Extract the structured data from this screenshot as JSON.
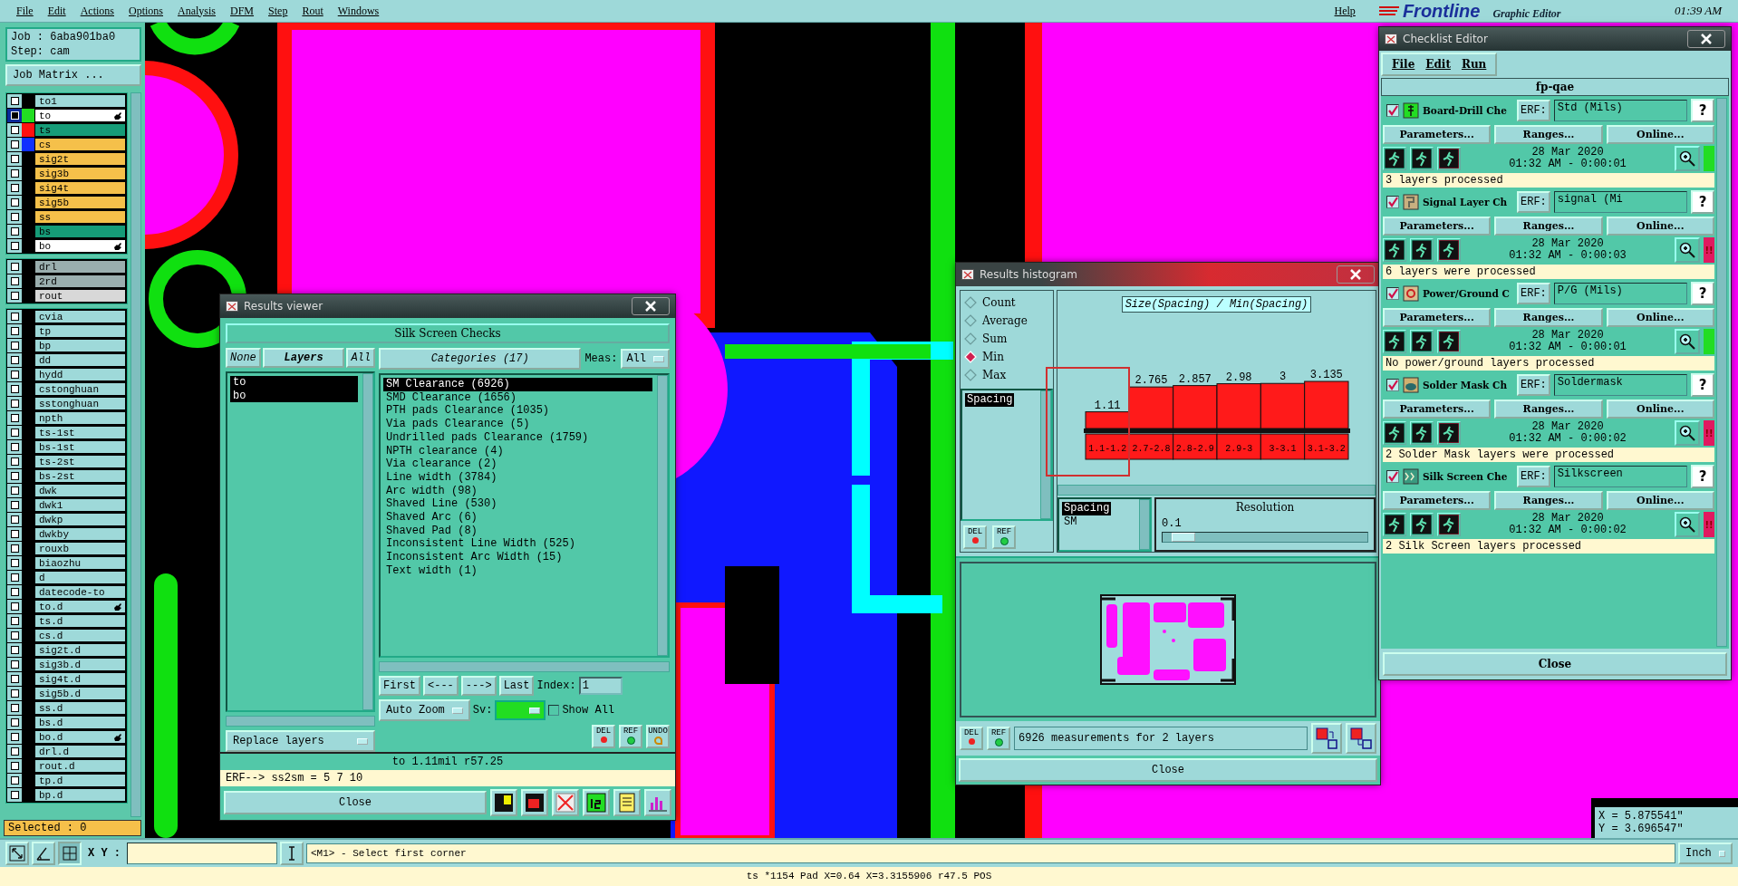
{
  "menu_bar": {
    "items": [
      "File",
      "Edit",
      "Actions",
      "Options",
      "Analysis",
      "DFM",
      "Step",
      "Rout",
      "Windows"
    ],
    "help": "Help"
  },
  "logo": {
    "brand": "Frontline",
    "subtitle": "Graphic Editor"
  },
  "clock": "01:39 AM",
  "job_panel": {
    "job": "Job : 6aba901ba0",
    "step": "Step: cam",
    "job_matrix": "Job Matrix ...",
    "selected_count": "Selected : 0",
    "layer_groups": [
      [
        {
          "name": "to1",
          "color": "#9ed9d9",
          "selected": false,
          "affected": false
        },
        {
          "name": "to",
          "color": "#ffffff",
          "swatch": {
            "color": "#22dd22"
          },
          "selected": true,
          "affected": true
        },
        {
          "name": "ts",
          "color": "#169c78",
          "swatch": {
            "color": "#ff1010"
          },
          "selected": false,
          "affected": false
        },
        {
          "name": "cs",
          "color": "#f5c04a",
          "swatch": {
            "color": "#1030ff"
          },
          "selected": false,
          "affected": false
        },
        {
          "name": "sig2t",
          "color": "#f5c04a",
          "selected": false,
          "affected": false
        },
        {
          "name": "sig3b",
          "color": "#f5c04a",
          "selected": false,
          "affected": false
        },
        {
          "name": "sig4t",
          "color": "#f5c04a",
          "selected": false,
          "affected": false
        },
        {
          "name": "sig5b",
          "color": "#f5c04a",
          "selected": false,
          "affected": false
        },
        {
          "name": "ss",
          "color": "#f5c04a",
          "selected": false,
          "affected": false
        },
        {
          "name": "bs",
          "color": "#169c78",
          "selected": false,
          "affected": false
        },
        {
          "name": "bo",
          "color": "#ffffff",
          "selected": false,
          "affected": true
        }
      ],
      [
        {
          "name": "drl",
          "color": "#9aaeae",
          "selected": false,
          "affected": false
        },
        {
          "name": "2rd",
          "color": "#9aaeae",
          "selected": false,
          "affected": false
        },
        {
          "name": "rout",
          "color": "#d8d8d8",
          "selected": false,
          "affected": false
        }
      ],
      [
        {
          "name": "cvia",
          "color": "#9ed9d9",
          "selected": false,
          "affected": false
        },
        {
          "name": "tp",
          "color": "#9ed9d9",
          "selected": false,
          "affected": false
        },
        {
          "name": "bp",
          "color": "#9ed9d9",
          "selected": false,
          "affected": false
        },
        {
          "name": "dd",
          "color": "#9ed9d9",
          "selected": false,
          "affected": false
        },
        {
          "name": "hydd",
          "color": "#9ed9d9",
          "selected": false,
          "affected": false
        },
        {
          "name": "cstonghuan",
          "color": "#9ed9d9",
          "selected": false,
          "affected": false
        },
        {
          "name": "sstonghuan",
          "color": "#9ed9d9",
          "selected": false,
          "affected": false
        },
        {
          "name": "npth",
          "color": "#9ed9d9",
          "selected": false,
          "affected": false
        },
        {
          "name": "ts-1st",
          "color": "#9ed9d9",
          "selected": false,
          "affected": false
        },
        {
          "name": "bs-1st",
          "color": "#9ed9d9",
          "selected": false,
          "affected": false
        },
        {
          "name": "ts-2st",
          "color": "#9ed9d9",
          "selected": false,
          "affected": false
        },
        {
          "name": "bs-2st",
          "color": "#9ed9d9",
          "selected": false,
          "affected": false
        },
        {
          "name": "dwk",
          "color": "#9ed9d9",
          "selected": false,
          "affected": false
        },
        {
          "name": "dwk1",
          "color": "#9ed9d9",
          "selected": false,
          "affected": false
        },
        {
          "name": "dwkp",
          "color": "#9ed9d9",
          "selected": false,
          "affected": false
        },
        {
          "name": "dwkby",
          "color": "#9ed9d9",
          "selected": false,
          "affected": false
        },
        {
          "name": "rouxb",
          "color": "#9ed9d9",
          "selected": false,
          "affected": false
        },
        {
          "name": "biaozhu",
          "color": "#9ed9d9",
          "selected": false,
          "affected": false
        },
        {
          "name": "d",
          "color": "#9ed9d9",
          "selected": false,
          "affected": false
        },
        {
          "name": "datecode-to",
          "color": "#9ed9d9",
          "selected": false,
          "affected": false
        },
        {
          "name": "to.d",
          "color": "#9ed9d9",
          "selected": false,
          "affected": true
        },
        {
          "name": "ts.d",
          "color": "#9ed9d9",
          "selected": false,
          "affected": false
        },
        {
          "name": "cs.d",
          "color": "#9ed9d9",
          "selected": false,
          "affected": false
        },
        {
          "name": "sig2t.d",
          "color": "#9ed9d9",
          "selected": false,
          "affected": false
        },
        {
          "name": "sig3b.d",
          "color": "#9ed9d9",
          "selected": false,
          "affected": false
        },
        {
          "name": "sig4t.d",
          "color": "#9ed9d9",
          "selected": false,
          "affected": false
        },
        {
          "name": "sig5b.d",
          "color": "#9ed9d9",
          "selected": false,
          "affected": false
        },
        {
          "name": "ss.d",
          "color": "#9ed9d9",
          "selected": false,
          "affected": false
        },
        {
          "name": "bs.d",
          "color": "#9ed9d9",
          "selected": false,
          "affected": false
        },
        {
          "name": "bo.d",
          "color": "#9ed9d9",
          "selected": false,
          "affected": true
        },
        {
          "name": "drl.d",
          "color": "#9ed9d9",
          "selected": false,
          "affected": false
        },
        {
          "name": "rout.d",
          "color": "#9ed9d9",
          "selected": false,
          "affected": false
        },
        {
          "name": "tp.d",
          "color": "#9ed9d9",
          "selected": false,
          "affected": false
        },
        {
          "name": "bp.d",
          "color": "#9ed9d9",
          "selected": false,
          "affected": false
        }
      ]
    ]
  },
  "results_viewer": {
    "title": "Results viewer",
    "heading": "Silk Screen Checks",
    "layer_buttons": [
      "None",
      "Layers",
      "All"
    ],
    "layers": [
      {
        "name": "to",
        "selected": true
      },
      {
        "name": "bo",
        "selected": true
      }
    ],
    "categories_header": "Categories (17)",
    "meas_label": "Meas:",
    "meas_value": "All",
    "categories": [
      {
        "label": "SM Clearance (6926)",
        "selected": true
      },
      {
        "label": "SMD Clearance (1656)",
        "selected": false
      },
      {
        "label": "PTH pads Clearance (1035)",
        "selected": false
      },
      {
        "label": "Via pads Clearance (5)",
        "selected": false
      },
      {
        "label": "Undrilled pads Clearance (1759)",
        "selected": false
      },
      {
        "label": "NPTH clearance (4)",
        "selected": false
      },
      {
        "label": "Via clearance (2)",
        "selected": false
      },
      {
        "label": "Line width (3784)",
        "selected": false
      },
      {
        "label": "Arc width (98)",
        "selected": false
      },
      {
        "label": "Shaved Line (530)",
        "selected": false
      },
      {
        "label": "Shaved Arc (6)",
        "selected": false
      },
      {
        "label": "Shaved Pad (8)",
        "selected": false
      },
      {
        "label": "Inconsistent Line Width (525)",
        "selected": false
      },
      {
        "label": "Inconsistent Arc Width (15)",
        "selected": false
      },
      {
        "label": "Text width (1)",
        "selected": false
      }
    ],
    "nav_buttons": [
      "First",
      "<---",
      "--->",
      "Last"
    ],
    "index_label": "Index:",
    "index_value": "1",
    "zoom_mode": "Auto Zoom",
    "sv_label": "Sv:",
    "show_all": {
      "label": "Show All",
      "checked": false
    },
    "replace_mode": "Replace layers",
    "action_buttons": [
      "DEL",
      "REF",
      "UNDO"
    ],
    "measurement": "to 1.11mil  r57.25",
    "erf_line": "ERF--> ss2sm = 5 7 10",
    "close": "Close"
  },
  "histogram": {
    "title": "Results histogram",
    "modes": [
      {
        "label": "Count",
        "selected": false
      },
      {
        "label": "Average",
        "selected": false
      },
      {
        "label": "Sum",
        "selected": false
      },
      {
        "label": "Min",
        "selected": true
      },
      {
        "label": "Max",
        "selected": false
      }
    ],
    "attributes": [
      {
        "label": "Spacing",
        "selected": true
      }
    ],
    "side_buttons": [
      "DEL",
      "REF"
    ],
    "chart_data": {
      "type": "bar",
      "title": "Size(Spacing) / Min(Spacing)",
      "categories": [
        "1.1-1.2",
        "2.7-2.8",
        "2.8-2.9",
        "2.9-3",
        "3-3.1",
        "3.1-3.2"
      ],
      "values": [
        1.11,
        2.765,
        2.857,
        2.98,
        3,
        3.135
      ],
      "data_labels": true
    },
    "fields": [
      {
        "label": "Spacing",
        "selected": true
      },
      {
        "label": "SM",
        "selected": false
      }
    ],
    "resolution": {
      "label": "Resolution",
      "value": "0.1",
      "level": 0.1
    },
    "footer_buttons": [
      "DEL",
      "REF"
    ],
    "summary": "6926 measurements for 2 layers",
    "close": "Close"
  },
  "checklist": {
    "title": "Checklist Editor",
    "menu": [
      "File",
      "Edit",
      "Run"
    ],
    "name": "fp-qae",
    "checks": [
      {
        "kind": "drill",
        "name": "Board-Drill Che",
        "checked": true,
        "erf_label": "ERF:",
        "erf": "Std (Mils)",
        "help": "?",
        "buttons": [
          "Parameters...",
          "Ranges...",
          "Online..."
        ],
        "date": "28 Mar 2020",
        "time": "01:32 AM - 0:00:01",
        "failed": false,
        "message": "3 layers processed"
      },
      {
        "kind": "signal",
        "name": "Signal Layer Ch",
        "checked": true,
        "erf_label": "ERF:",
        "erf": "signal (Mi",
        "help": "?",
        "buttons": [
          "Parameters...",
          "Ranges...",
          "Online..."
        ],
        "date": "28 Mar 2020",
        "time": "01:32 AM - 0:00:03",
        "failed": true,
        "status_mark": "!!",
        "message": "6 layers were processed"
      },
      {
        "kind": "power",
        "name": "Power/Ground C",
        "checked": true,
        "erf_label": "ERF:",
        "erf": "P/G (Mils)",
        "help": "?",
        "buttons": [
          "Parameters...",
          "Ranges...",
          "Online..."
        ],
        "date": "28 Mar 2020",
        "time": "01:32 AM - 0:00:01",
        "failed": false,
        "message": "No power/ground layers processed"
      },
      {
        "kind": "mask",
        "name": "Solder Mask Ch",
        "checked": true,
        "erf_label": "ERF:",
        "erf": "Soldermask",
        "help": "?",
        "buttons": [
          "Parameters...",
          "Ranges...",
          "Online..."
        ],
        "date": "28 Mar 2020",
        "time": "01:32 AM - 0:00:02",
        "failed": true,
        "status_mark": "!!",
        "message": "2 Solder Mask layers were processed"
      },
      {
        "kind": "silk",
        "name": "Silk Screen Che",
        "checked": true,
        "erf_label": "ERF:",
        "erf": "Silkscreen",
        "help": "?",
        "buttons": [
          "Parameters...",
          "Ranges...",
          "Online..."
        ],
        "date": "28 Mar 2020",
        "time": "01:32 AM - 0:00:02",
        "failed": true,
        "status_mark": "!!",
        "message": "2 Silk Screen layers processed"
      }
    ],
    "close": "Close"
  },
  "coordinates": {
    "x": "X = 5.875541\"",
    "y": "Y = 3.696547\""
  },
  "toolbar": {
    "xy_label": "X Y :",
    "prompt": "<M1> - Select first corner",
    "units": "Inch"
  },
  "status_bar": "ts *1154 Pad X=0.64 X=3.3155906 r47.5 POS"
}
